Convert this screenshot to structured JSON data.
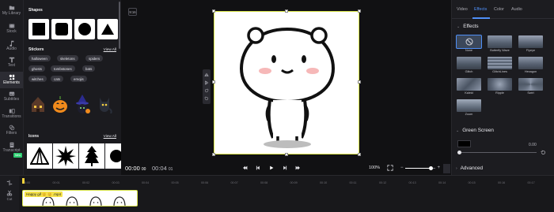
{
  "rail": {
    "items": [
      {
        "label": "My Library",
        "icon": "folder-icon"
      },
      {
        "label": "Stock",
        "icon": "film-icon"
      },
      {
        "label": "Audio",
        "icon": "music-icon"
      },
      {
        "label": "Text",
        "icon": "text-icon"
      },
      {
        "label": "Elements",
        "icon": "elements-icon",
        "active": true
      },
      {
        "label": "Subtitles",
        "icon": "subtitles-icon"
      },
      {
        "label": "Transitions",
        "icon": "transitions-icon"
      },
      {
        "label": "Filters",
        "icon": "filters-icon"
      },
      {
        "label": "Transcript",
        "icon": "transcript-icon",
        "badge": "New"
      }
    ]
  },
  "panel": {
    "shapes_title": "Shapes",
    "shapes": [
      "square",
      "rounded-square",
      "circle",
      "triangle"
    ],
    "stickers_title": "Stickers",
    "stickers_view_all": "View All",
    "chips": [
      "halloween",
      "skeletons",
      "spiders",
      "ghosts",
      "tombstones",
      "bats",
      "witches",
      "cats",
      "emojis"
    ],
    "sticker_items": [
      "haunted-house-sticker",
      "jack-o-lantern-sticker",
      "witch-cat-sticker",
      "black-cat-sticker"
    ],
    "icons_title": "Icons",
    "icons_view_all": "View All",
    "icon_items": [
      "pyramid-icon",
      "starburst-icon",
      "pine-tree-icon",
      "sun-icon"
    ]
  },
  "stage": {
    "ratio_label": "9:16",
    "time_current": "00:00",
    "time_current_frames": "00",
    "time_total": "00:04",
    "time_total_frames": "01",
    "zoom": "100%"
  },
  "props": {
    "tabs": [
      "Video",
      "Effects",
      "Color",
      "Audio"
    ],
    "active_tab": "Effects",
    "effects_title": "Effects",
    "effects": [
      {
        "name": "None",
        "selected": true
      },
      {
        "name": "Butterfly Wave"
      },
      {
        "name": "Flyeye"
      },
      {
        "name": "Glitch"
      },
      {
        "name": "GlitchLines"
      },
      {
        "name": "Hexagon"
      },
      {
        "name": "Kaleid"
      },
      {
        "name": "Ripple"
      },
      {
        "name": "Swirl"
      },
      {
        "name": "Zoom"
      }
    ],
    "green_screen_title": "Green Screen",
    "green_screen_value": "0.00",
    "green_screen_level": 0,
    "advanced_title": "Advanced"
  },
  "timeline": {
    "cut_label": "Cut",
    "ticks": [
      "00:00",
      "00:01",
      "00:02",
      "00:03",
      "00:04",
      "00:05",
      "00:06",
      "00:07",
      "00:08",
      "00:09",
      "00:10",
      "00:11",
      "00:12",
      "00:13",
      "00:14",
      "00:15",
      "00:16",
      "00:17"
    ],
    "clip_label": "Happy gif 😊 😊 .mp4"
  },
  "colors": {
    "accent": "#4f8ff7",
    "selection": "#d9e64a",
    "playhead": "#f2d23c",
    "new_badge": "#2ecc71"
  }
}
